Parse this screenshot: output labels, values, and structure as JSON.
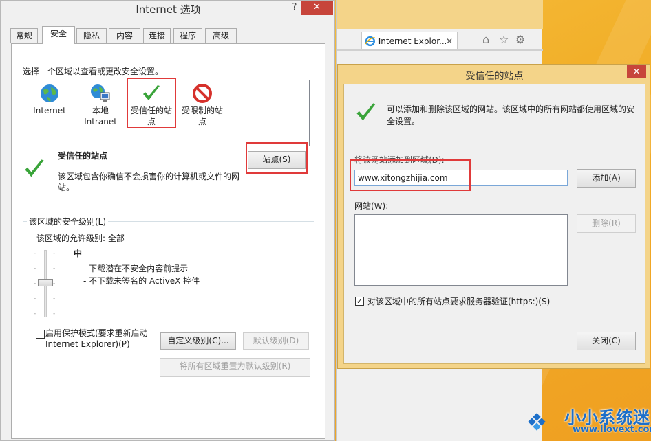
{
  "colors": {
    "accent_red": "#e03a3a",
    "close_red": "#c7453b",
    "check_green": "#3aa43a",
    "desktop_orange": "#f2b02a"
  },
  "io": {
    "title": "Internet 选项",
    "help": "?",
    "close": "✕",
    "tabs": [
      "常规",
      "安全",
      "隐私",
      "内容",
      "连接",
      "程序",
      "高级"
    ],
    "zone_prompt": "选择一个区域以查看或更改安全设置。",
    "zones": [
      "Internet",
      "本地\nIntranet",
      "受信任的站\n点",
      "受限制的站\n点"
    ],
    "trusted_title": "受信任的站点",
    "trusted_desc": "该区域包含你确信不会损害你的计算机或文件的网站。",
    "sites_button": "站点(S)",
    "security_group": "该区域的安全级别(L)",
    "allowed_level": "该区域的允许级别: 全部",
    "level_name": "中",
    "bullets": [
      "- 下载潜在不安全内容前提示",
      "- 不下载未签名的 ActiveX 控件"
    ],
    "protect_mode": "启用保护模式(要求重新启动\nInternet Explorer)(P)",
    "custom_level": "自定义级别(C)...",
    "default_level": "默认级别(D)",
    "reset_all": "将所有区域重置为默认级别(R)"
  },
  "ie": {
    "tab_label": "Internet Explor...",
    "tab_close": "✕",
    "icons": [
      "home-icon",
      "star-icon",
      "gear-icon"
    ]
  },
  "ts": {
    "title": "受信任的站点",
    "close": "✕",
    "info": "可以添加和删除该区域的网站。该区域中的所有网站都使用区域的安全设置。",
    "add_label": "将该网站添加到区域(D):",
    "input_value": "www.xitongzhijia.com",
    "add_button": "添加(A)",
    "websites_label": "网站(W):",
    "remove_button": "删除(R)",
    "https_label": "对该区域中的所有站点要求服务器验证(https:)(S)",
    "https_checked": true,
    "close_button": "关闭(C)"
  },
  "watermark": {
    "name": "小小系统迷",
    "url": "www.ilovext.com"
  }
}
